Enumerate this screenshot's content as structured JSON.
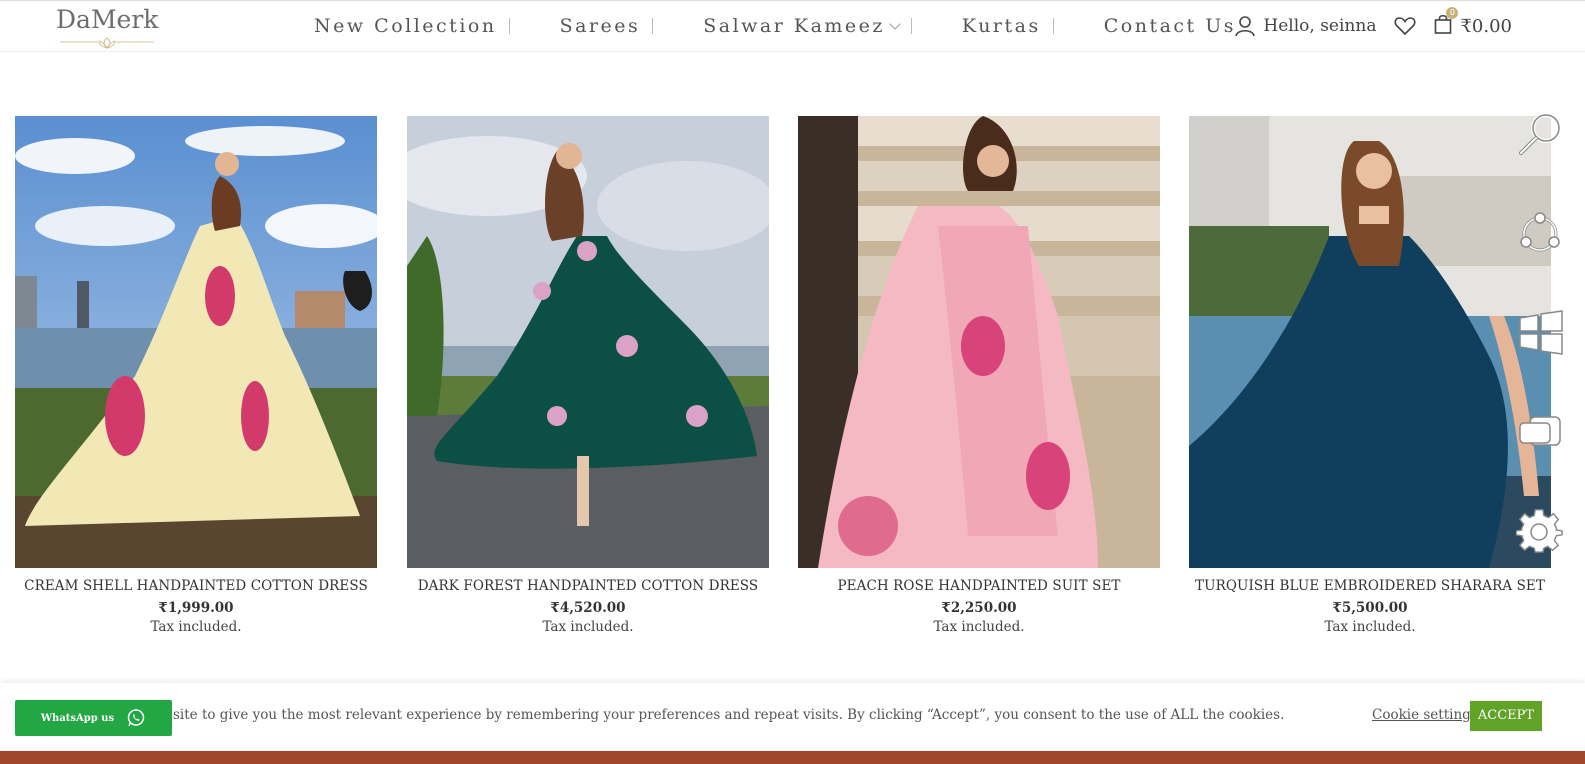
{
  "brand": {
    "name": "DaMerk"
  },
  "nav": {
    "items": [
      "New Collection",
      "Sarees",
      "Salwar Kameez",
      "Kurtas",
      "Contact Us"
    ]
  },
  "account": {
    "greeting": "Hello, seinna"
  },
  "cart": {
    "count": "0",
    "total": "₹0.00"
  },
  "products": [
    {
      "title": "CREAM SHELL HANDPAINTED COTTON DRESS",
      "price": "₹1,999.00",
      "tax": "Tax included."
    },
    {
      "title": "DARK FOREST HANDPAINTED COTTON DRESS",
      "price": "₹4,520.00",
      "tax": "Tax included."
    },
    {
      "title": "PEACH ROSE HANDPAINTED SUIT SET",
      "price": "₹2,250.00",
      "tax": "Tax included."
    },
    {
      "title": "TURQUISH BLUE EMBROIDERED SHARARA SET",
      "price": "₹5,500.00",
      "tax": "Tax included."
    }
  ],
  "side_icons": [
    "magnifier-icon",
    "network-icon",
    "windows-icon",
    "window-switch-icon",
    "gear-icon"
  ],
  "cookie": {
    "text": "site to give you the most relevant experience by remembering your preferences and repeat visits. By clicking “Accept”, you consent to the use of ALL the cookies.",
    "settings_label": "Cookie settings",
    "accept_label": "ACCEPT"
  },
  "whatsapp": {
    "label": "WhatsApp us"
  },
  "colors": {
    "accent_green": "#61a229",
    "whatsapp_green": "#23a644",
    "taskbar": "#a0472c"
  }
}
